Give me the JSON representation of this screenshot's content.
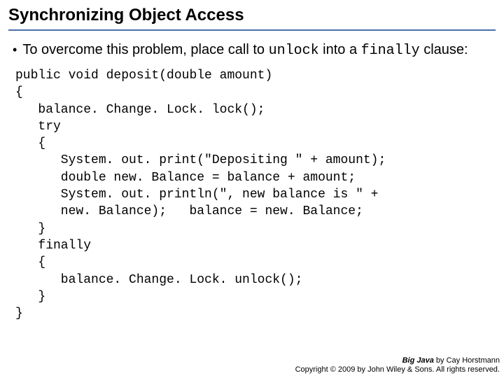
{
  "title": "Synchronizing Object Access",
  "bullet": {
    "pre": "To overcome this problem, place call to ",
    "code1": "unlock",
    "mid": " into a ",
    "code2": "finally",
    "post": " clause:"
  },
  "code": {
    "l1": "public void deposit(double amount)",
    "l2": "{",
    "l3": "   balance. Change. Lock. lock();",
    "l4": "   try",
    "l5": "   {",
    "l6": "      System. out. print(\"Depositing \" + amount);",
    "l7": "      double new. Balance = balance + amount;",
    "l8": "      System. out. println(\", new balance is \" +",
    "l9": "      new. Balance);   balance = new. Balance;",
    "l10": "   }",
    "l11": "   finally",
    "l12": "   {",
    "l13": "      balance. Change. Lock. unlock();",
    "l14": "   }",
    "l15": "}"
  },
  "footer": {
    "book": "Big Java",
    "by": " by Cay Horstmann",
    "copy": "Copyright © 2009 by John Wiley & Sons. All rights reserved."
  }
}
